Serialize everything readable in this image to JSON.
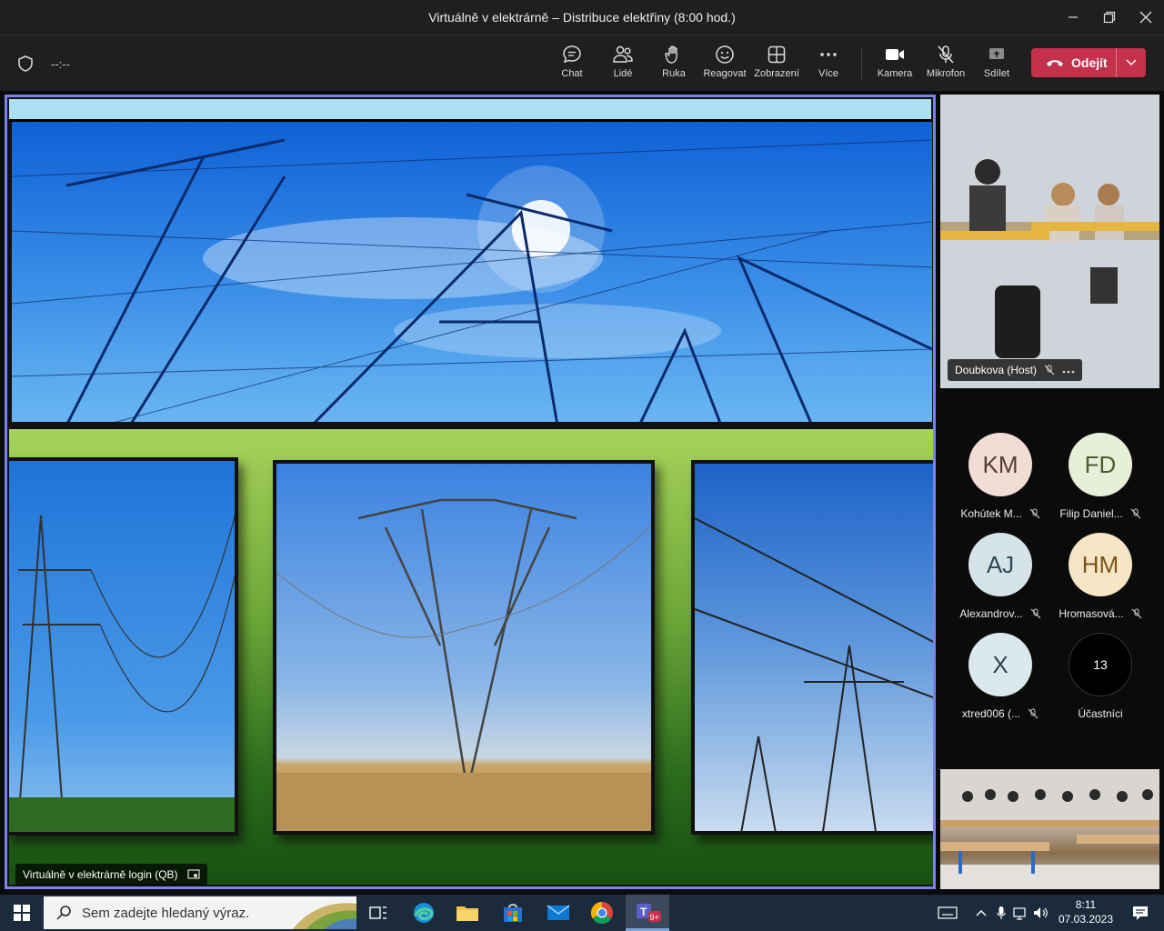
{
  "window": {
    "title": "Virtuálně v elektrárně – Distribuce elektřiny (8:00 hod.)"
  },
  "toolbar": {
    "timer": "--:--",
    "chat": "Chat",
    "people": "Lidé",
    "hand": "Ruka",
    "react": "Reagovat",
    "view": "Zobrazení",
    "more": "Více",
    "camera": "Kamera",
    "mic": "Mikrofon",
    "share": "Sdílet",
    "leave": "Odejít"
  },
  "stage": {
    "presenter": "Virtuálně v elektrárně login (QB)"
  },
  "participants": {
    "host_camera_name": "Doubkova (Host)",
    "list": [
      {
        "initials": "KM",
        "name": "Kohútek M...",
        "bg": "#f1dcd6",
        "fg": "#5a3d35"
      },
      {
        "initials": "FD",
        "name": "Filip Daniel...",
        "bg": "#e8efd8",
        "fg": "#4b5d2a"
      },
      {
        "initials": "AJ",
        "name": "Alexandrov...",
        "bg": "#d6e4ea",
        "fg": "#2d4a57"
      },
      {
        "initials": "HM",
        "name": "Hromasová...",
        "bg": "#f6e6c6",
        "fg": "#7a5418"
      },
      {
        "initials": "X",
        "name": "xtred006 (...",
        "bg": "#dbe8ee",
        "fg": "#2b4652"
      }
    ],
    "count": "13",
    "count_label": "Účastníci"
  },
  "taskbar": {
    "search_placeholder": "Sem zadejte hledaný výraz.",
    "teams_badge": "9+",
    "time": "8:11",
    "date": "07.03.2023"
  },
  "colors": {
    "leave": "#c4314b",
    "stage_border": "#7b83eb",
    "taskbar": "#1b2b3b"
  }
}
